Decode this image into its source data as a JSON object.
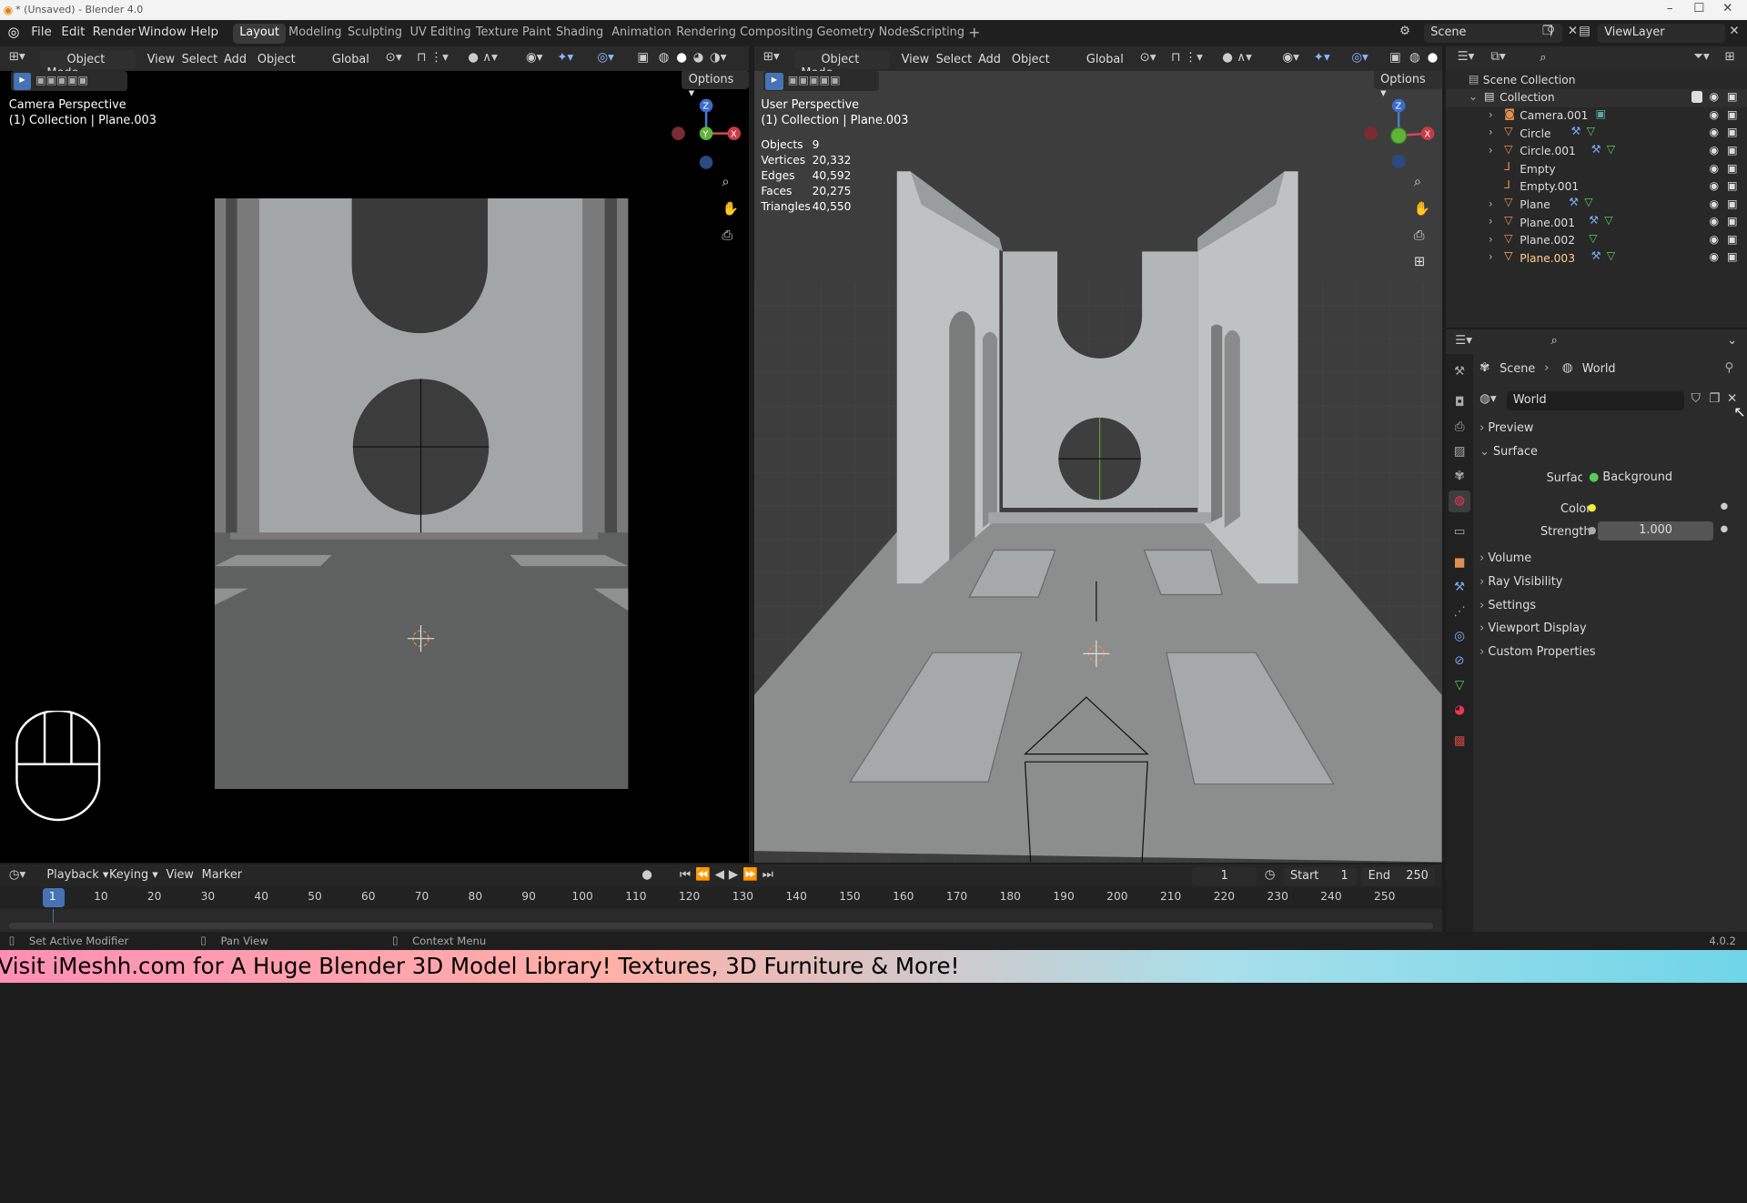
{
  "window": {
    "title": "* (Unsaved) - Blender 4.0",
    "controls": [
      "–",
      "☐",
      "✕"
    ]
  },
  "menu": [
    "File",
    "Edit",
    "Render",
    "Window",
    "Help"
  ],
  "workspaces": [
    "Layout",
    "Modeling",
    "Sculpting",
    "UV Editing",
    "Texture Paint",
    "Shading",
    "Animation",
    "Rendering",
    "Compositing",
    "Geometry Nodes",
    "Scripting",
    "+"
  ],
  "scene_name": "Scene",
  "view_layer": "ViewLayer",
  "viewport_left": {
    "mode": "Object Mode",
    "menus": [
      "View",
      "Select",
      "Add",
      "Object"
    ],
    "transform": "Global",
    "options": "Options",
    "overlay_line1": "Camera Perspective",
    "overlay_line2": "(1) Collection | Plane.003"
  },
  "viewport_right": {
    "mode": "Object Mode",
    "menus": [
      "View",
      "Select",
      "Add",
      "Object"
    ],
    "transform": "Global",
    "options": "Options",
    "overlay_line1": "User Perspective",
    "overlay_line2": "(1) Collection | Plane.003",
    "stats": [
      {
        "label": "Objects",
        "value": "9"
      },
      {
        "label": "Vertices",
        "value": "20,332"
      },
      {
        "label": "Edges",
        "value": "40,592"
      },
      {
        "label": "Faces",
        "value": "20,275"
      },
      {
        "label": "Triangles",
        "value": "40,550"
      }
    ]
  },
  "gizmo": {
    "x": "X",
    "y": "Y",
    "z": "Z"
  },
  "outliner": {
    "root": "Scene Collection",
    "collection": "Collection",
    "items": [
      "Camera.001",
      "Circle",
      "Circle.001",
      "Empty",
      "Empty.001",
      "Plane",
      "Plane.001",
      "Plane.002",
      "Plane.003"
    ]
  },
  "properties": {
    "breadcrumb_scene": "Scene",
    "breadcrumb_world": "World",
    "world_name": "World",
    "sections": [
      "Preview",
      "Surface",
      "Volume",
      "Ray Visibility",
      "Settings",
      "Viewport Display",
      "Custom Properties"
    ],
    "surface_label": "Surface",
    "surface_value": "Background",
    "color_label": "Color",
    "strength_label": "Strength",
    "strength_value": "1.000"
  },
  "timeline": {
    "menus": [
      "Playback",
      "Keying",
      "View",
      "Marker"
    ],
    "current_frame": "1",
    "start_label": "Start",
    "start_value": "1",
    "end_label": "End",
    "end_value": "250",
    "ticks": [
      "1",
      "10",
      "20",
      "30",
      "40",
      "50",
      "60",
      "70",
      "80",
      "90",
      "100",
      "110",
      "120",
      "130",
      "140",
      "150",
      "160",
      "170",
      "180",
      "190",
      "200",
      "210",
      "220",
      "230",
      "240",
      "250"
    ]
  },
  "status": {
    "left": "Set Active Modifier",
    "middle": "Pan View",
    "right": "Context Menu",
    "version": "4.0.2"
  },
  "banner": "Visit iMeshh.com for A Huge Blender 3D Model Library! Textures, 3D Furniture & More!"
}
